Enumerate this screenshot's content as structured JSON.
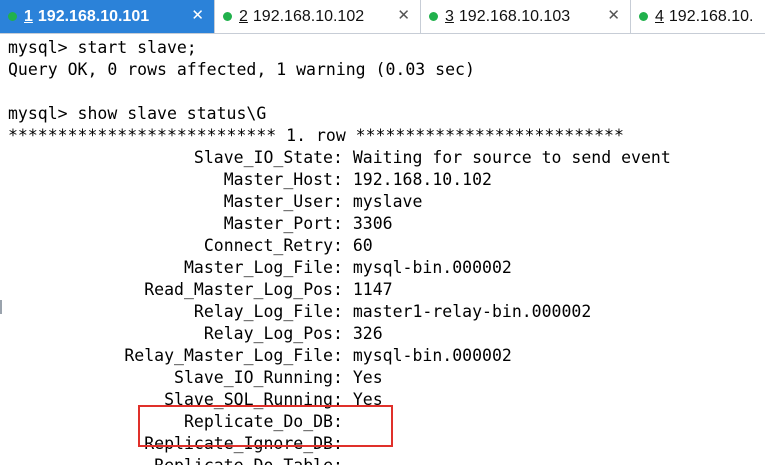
{
  "tabs": [
    {
      "num": "1",
      "label": "192.168.10.101",
      "close": "✕",
      "active": true
    },
    {
      "num": "2",
      "label": "192.168.10.102",
      "close": "✕",
      "active": false
    },
    {
      "num": "3",
      "label": "192.168.10.103",
      "close": "✕",
      "active": false
    },
    {
      "num": "4",
      "label": "192.168.10.",
      "close": "",
      "active": false
    }
  ],
  "colors": {
    "active_tab": "#2b82d9",
    "status_dot": "#21b14c",
    "highlight_border": "#e0302a"
  },
  "terminal": {
    "lines": [
      "mysql> start slave;",
      "Query OK, 0 rows affected, 1 warning (0.03 sec)",
      "",
      "mysql> show slave status\\G",
      "*************************** 1. row ***************************"
    ],
    "fields": [
      {
        "key": "Slave_IO_State",
        "value": "Waiting for source to send event"
      },
      {
        "key": "Master_Host",
        "value": "192.168.10.102"
      },
      {
        "key": "Master_User",
        "value": "myslave"
      },
      {
        "key": "Master_Port",
        "value": "3306"
      },
      {
        "key": "Connect_Retry",
        "value": "60"
      },
      {
        "key": "Master_Log_File",
        "value": "mysql-bin.000002"
      },
      {
        "key": "Read_Master_Log_Pos",
        "value": "1147"
      },
      {
        "key": "Relay_Log_File",
        "value": "master1-relay-bin.000002"
      },
      {
        "key": "Relay_Log_Pos",
        "value": "326"
      },
      {
        "key": "Relay_Master_Log_File",
        "value": "mysql-bin.000002"
      },
      {
        "key": "Slave_IO_Running",
        "value": "Yes"
      },
      {
        "key": "Slave_SQL_Running",
        "value": "Yes"
      },
      {
        "key": "Replicate_Do_DB",
        "value": ""
      },
      {
        "key": "Replicate_Ignore_DB",
        "value": ""
      },
      {
        "key": "Replicate_Do_Table",
        "value": ""
      }
    ],
    "field_separator": ": "
  }
}
